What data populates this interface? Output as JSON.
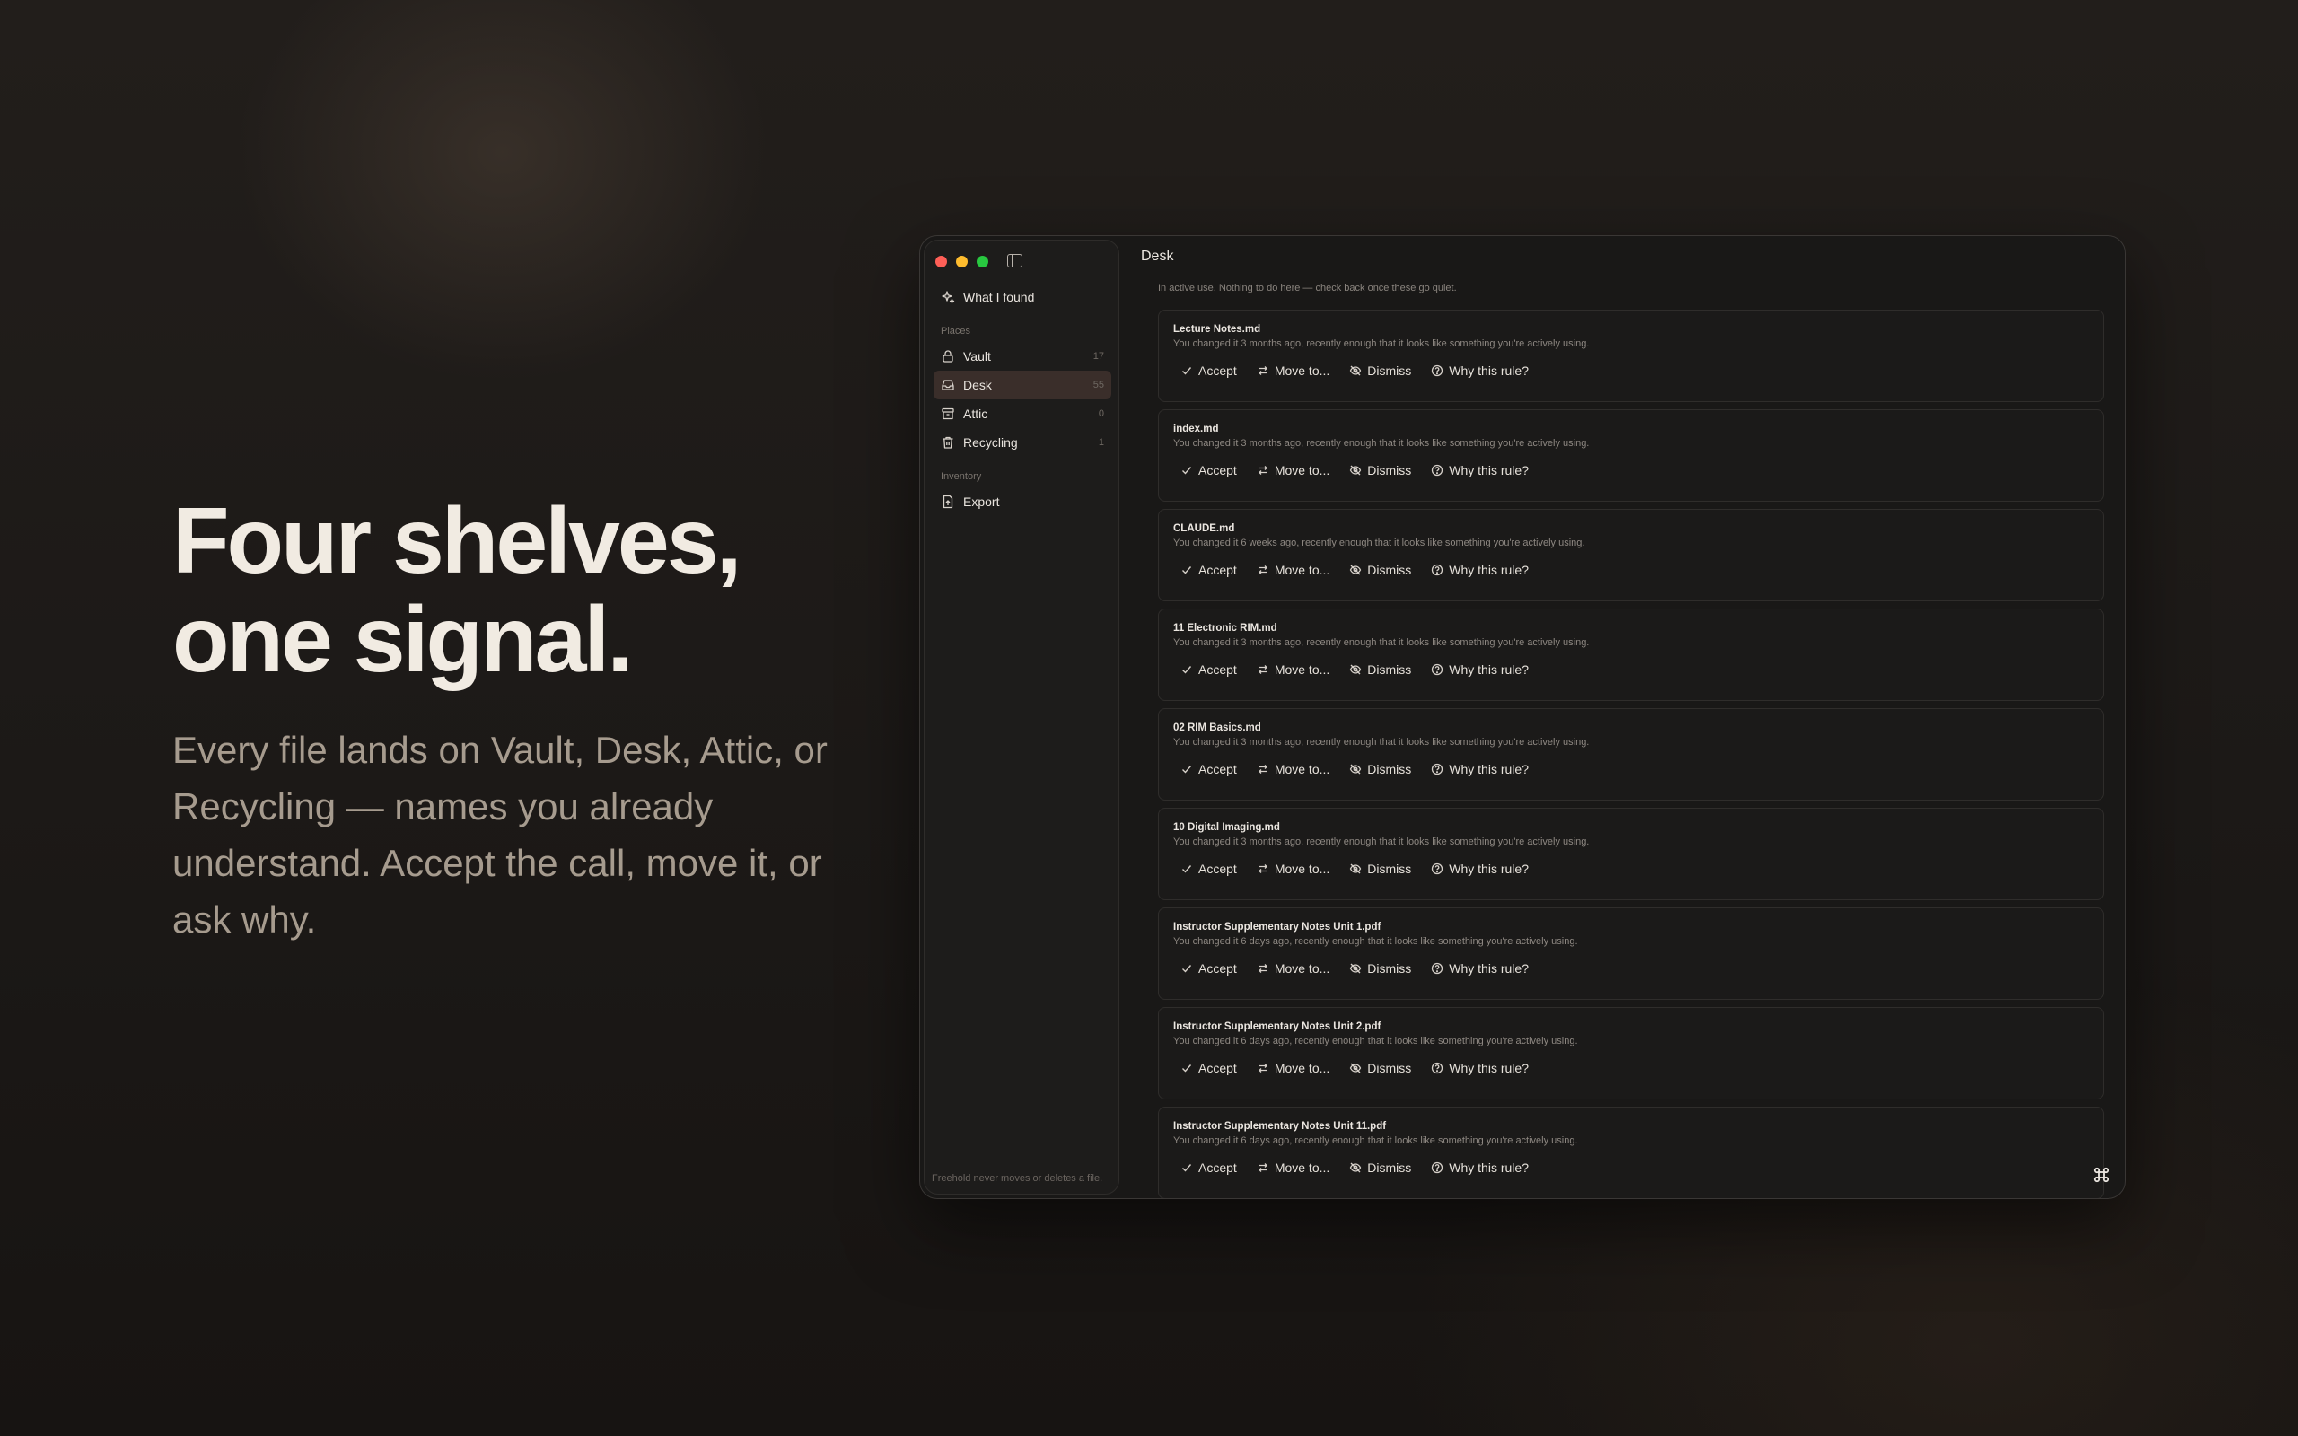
{
  "hero": {
    "title_line1": "Four shelves,",
    "title_line2": "one signal.",
    "body": "Every file lands on Vault, Desk, Attic, or Recycling — names you already understand. Accept the call, move it, or ask why."
  },
  "sidebar": {
    "what_i_found": "What I found",
    "places_label": "Places",
    "places": [
      {
        "label": "Vault",
        "count": "17",
        "icon": "lock-icon"
      },
      {
        "label": "Desk",
        "count": "55",
        "icon": "inbox-icon",
        "active": true
      },
      {
        "label": "Attic",
        "count": "0",
        "icon": "archive-icon"
      },
      {
        "label": "Recycling",
        "count": "1",
        "icon": "trash-icon"
      }
    ],
    "inventory_label": "Inventory",
    "export_label": "Export",
    "footer": "Freehold never moves or deletes a file."
  },
  "main": {
    "title": "Desk",
    "subtitle": "In active use. Nothing to do here — check back once these go quiet.",
    "actions": {
      "accept": "Accept",
      "move": "Move to...",
      "dismiss": "Dismiss",
      "why": "Why this rule?"
    },
    "files": [
      {
        "name": "Lecture Notes.md",
        "desc": "You changed it 3 months ago, recently enough that it looks like something you're actively using."
      },
      {
        "name": "index.md",
        "desc": "You changed it 3 months ago, recently enough that it looks like something you're actively using."
      },
      {
        "name": "CLAUDE.md",
        "desc": "You changed it 6 weeks ago, recently enough that it looks like something you're actively using."
      },
      {
        "name": "11 Electronic RIM.md",
        "desc": "You changed it 3 months ago, recently enough that it looks like something you're actively using."
      },
      {
        "name": "02 RIM Basics.md",
        "desc": "You changed it 3 months ago, recently enough that it looks like something you're actively using."
      },
      {
        "name": "10 Digital Imaging.md",
        "desc": "You changed it 3 months ago, recently enough that it looks like something you're actively using."
      },
      {
        "name": "Instructor Supplementary Notes Unit 1.pdf",
        "desc": "You changed it 6 days ago, recently enough that it looks like something you're actively using."
      },
      {
        "name": "Instructor Supplementary Notes Unit 2.pdf",
        "desc": "You changed it 6 days ago, recently enough that it looks like something you're actively using."
      },
      {
        "name": "Instructor Supplementary Notes Unit 11.pdf",
        "desc": "You changed it 6 days ago, recently enough that it looks like something you're actively using."
      }
    ]
  },
  "colors": {
    "active_row": "#3a2e2a",
    "traffic_red": "#fe5f57",
    "traffic_yellow": "#febc2e",
    "traffic_green": "#28c840"
  }
}
